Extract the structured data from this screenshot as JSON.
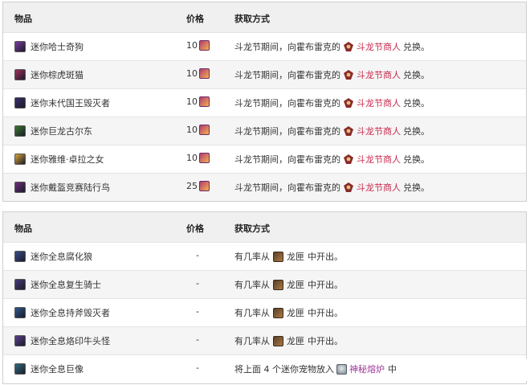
{
  "table1": {
    "headers": {
      "item": "物品",
      "price": "价格",
      "source": "获取方式"
    },
    "rows": [
      {
        "name": "迷你哈士奇狗",
        "icon_color": "#7b3fa0",
        "price": "10",
        "source": {
          "before": "斗龙节期间，向霍布雷克的",
          "link": "斗龙节商人",
          "after": "兑换。"
        }
      },
      {
        "name": "迷你棕虎斑猫",
        "icon_color": "#a2305c",
        "price": "10",
        "source": {
          "before": "斗龙节期间，向霍布雷克的",
          "link": "斗龙节商人",
          "after": "兑换。"
        }
      },
      {
        "name": "迷你末代国王毁灭者",
        "icon_color": "#3a2f6a",
        "price": "10",
        "source": {
          "before": "斗龙节期间，向霍布雷克的",
          "link": "斗龙节商人",
          "after": "兑换。"
        }
      },
      {
        "name": "迷你巨龙古尔东",
        "icon_color": "#3c7a2f",
        "price": "10",
        "source": {
          "before": "斗龙节期间，向霍布雷克的",
          "link": "斗龙节商人",
          "after": "兑换。"
        }
      },
      {
        "name": "迷你雅维·卓拉之女",
        "icon_color": "#d7a43a",
        "price": "10",
        "source": {
          "before": "斗龙节期间，向霍布雷克的",
          "link": "斗龙节商人",
          "after": "兑换。"
        }
      },
      {
        "name": "迷你戴盔竞赛陆行鸟",
        "icon_color": "#6a2f7a",
        "price": "25",
        "source": {
          "before": "斗龙节期间，向霍布雷克的",
          "link": "斗龙节商人",
          "after": "兑换。"
        }
      }
    ]
  },
  "table2": {
    "headers": {
      "item": "物品",
      "price": "价格",
      "source": "获取方式"
    },
    "rows": [
      {
        "name": "迷你全息腐化狼",
        "icon_color": "#3a4e8a",
        "price": "-",
        "source": {
          "before": "有几率从",
          "link": "龙匣",
          "after": "中开出。"
        }
      },
      {
        "name": "迷你全息复生骑士",
        "icon_color": "#4a3a7a",
        "price": "-",
        "source": {
          "before": "有几率从",
          "link": "龙匣",
          "after": "中开出。"
        }
      },
      {
        "name": "迷你全息持斧毁灭者",
        "icon_color": "#2f5a8a",
        "price": "-",
        "source": {
          "before": "有几率从",
          "link": "龙匣",
          "after": "中开出。"
        }
      },
      {
        "name": "迷你全息烙印牛头怪",
        "icon_color": "#5a3f8a",
        "price": "-",
        "source": {
          "before": "有几率从",
          "link": "龙匣",
          "after": "中开出。"
        }
      },
      {
        "name": "迷你全息巨像",
        "icon_color": "#2f6a7a",
        "price": "-",
        "source": {
          "before": "将上面 4 个迷你宠物放入",
          "link": "神秘熔炉",
          "after": "中"
        }
      }
    ]
  },
  "colors": {
    "link_red": "#c8294d",
    "link_purple": "#a13a9a"
  }
}
